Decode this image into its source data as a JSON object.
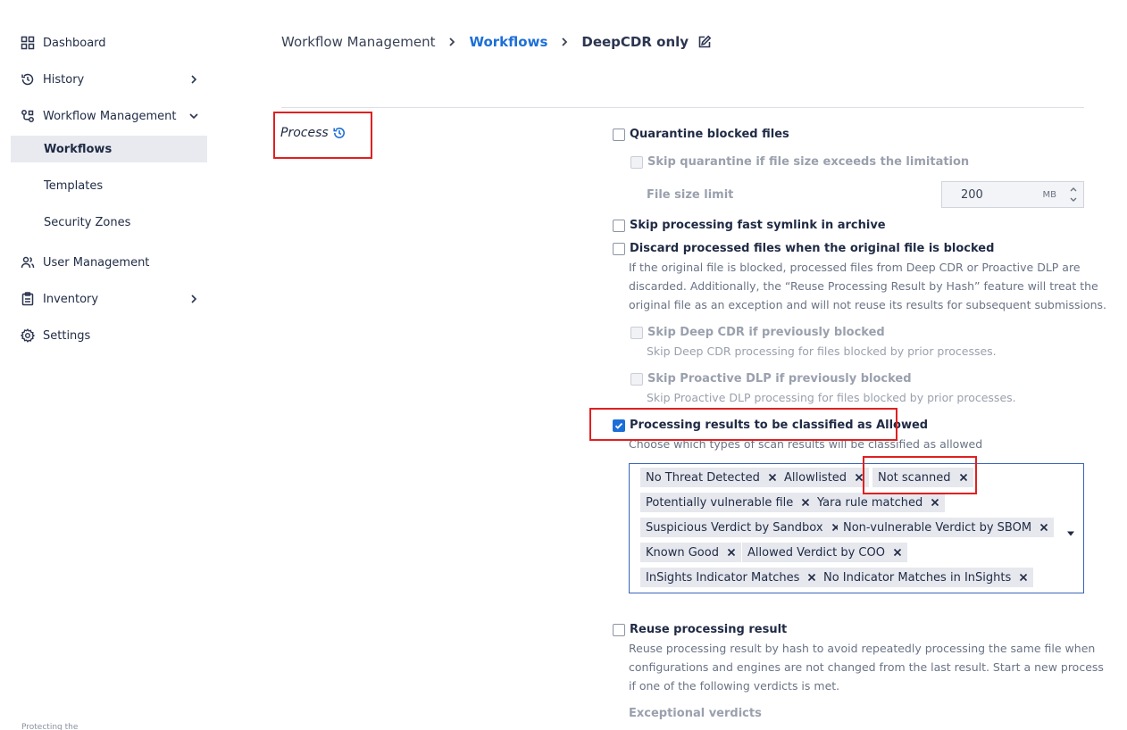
{
  "sidebar": {
    "items": [
      {
        "label": "Dashboard",
        "icon": "grid-icon"
      },
      {
        "label": "History",
        "icon": "history-icon"
      },
      {
        "label": "Workflow Management",
        "icon": "workflow-icon"
      },
      {
        "label": "User Management",
        "icon": "users-icon"
      },
      {
        "label": "Inventory",
        "icon": "clipboard-icon"
      },
      {
        "label": "Settings",
        "icon": "gear-icon"
      }
    ],
    "sub_items": [
      {
        "label": "Workflows",
        "active": true
      },
      {
        "label": "Templates",
        "active": false
      },
      {
        "label": "Security Zones",
        "active": false
      }
    ],
    "footer": "Protecting the"
  },
  "breadcrumb": {
    "root": "Workflow Management",
    "link": "Workflows",
    "current": "DeepCDR only"
  },
  "section": {
    "title": "Process"
  },
  "settings": {
    "quarantine": {
      "label": "Quarantine blocked files",
      "checked": false
    },
    "skip_quarantine": {
      "label": "Skip quarantine if file size exceeds the limitation",
      "disabled": true
    },
    "file_size": {
      "label": "File size limit",
      "value": "200",
      "unit": "MB"
    },
    "skip_symlink": {
      "label": "Skip processing fast symlink in archive",
      "checked": false
    },
    "discard": {
      "label": "Discard processed files when the original file is blocked",
      "desc_lines": [
        "If the original file is blocked, processed files from Deep CDR or Proactive DLP are",
        "discarded. Additionally, the “Reuse Processing Result by Hash” feature will treat the",
        "original file as an exception and will not reuse its results for subsequent submissions."
      ]
    },
    "skip_cdr": {
      "label": "Skip Deep CDR if previously blocked",
      "desc": "Skip Deep CDR processing for files blocked by prior processes."
    },
    "skip_dlp": {
      "label": "Skip Proactive DLP if previously blocked",
      "desc": "Skip Proactive DLP processing for files blocked by prior processes."
    },
    "allowed": {
      "label": "Processing results to be classified as Allowed",
      "checked": true,
      "desc": "Choose which types of scan results will be classified as allowed",
      "tags": [
        "No Threat Detected",
        "Allowlisted",
        "Not scanned",
        "Potentially vulnerable file",
        "Yara rule matched",
        "Suspicious Verdict by Sandbox",
        "Non-vulnerable Verdict by SBOM",
        "Known Good",
        "Allowed Verdict by COO",
        "InSights Indicator Matches",
        "No Indicator Matches in InSights"
      ]
    },
    "reuse": {
      "label": "Reuse processing result",
      "checked": false,
      "desc_lines": [
        "Reuse processing result by hash to avoid repeatedly processing the same file when",
        "configurations and engines are not changed from the last result. Start a new process",
        "if one of the following verdicts is met."
      ],
      "sub_label": "Exceptional verdicts"
    }
  },
  "colors": {
    "accent": "#1d6fd8",
    "highlight": "#e02020"
  }
}
